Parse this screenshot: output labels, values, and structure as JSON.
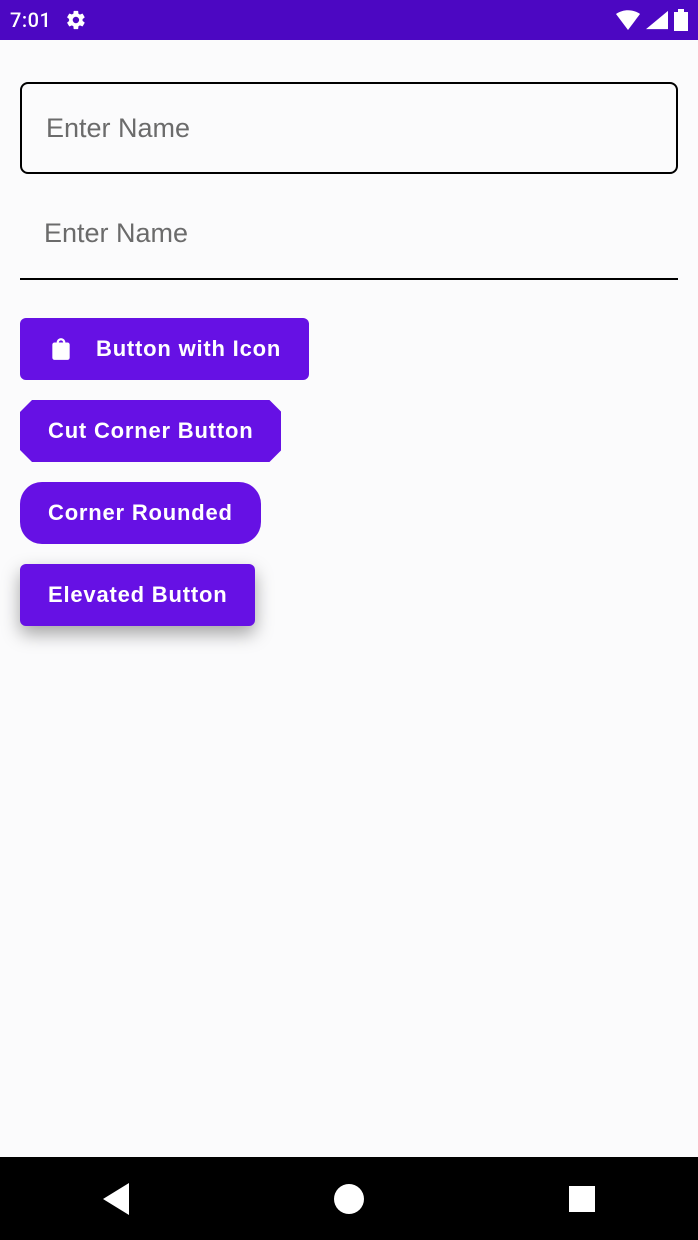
{
  "statusbar": {
    "time": "7:01"
  },
  "inputs": {
    "outlined": {
      "placeholder": "Enter Name",
      "value": ""
    },
    "underline": {
      "placeholder": "Enter Name",
      "value": ""
    }
  },
  "buttons": {
    "icon_button": "Button with Icon",
    "cut_corner": "Cut Corner Button",
    "corner_rounded": "Corner Rounded",
    "elevated": "Elevated Button"
  },
  "colors": {
    "primary": "#6611E4",
    "statusbar": "#4C07C2"
  }
}
